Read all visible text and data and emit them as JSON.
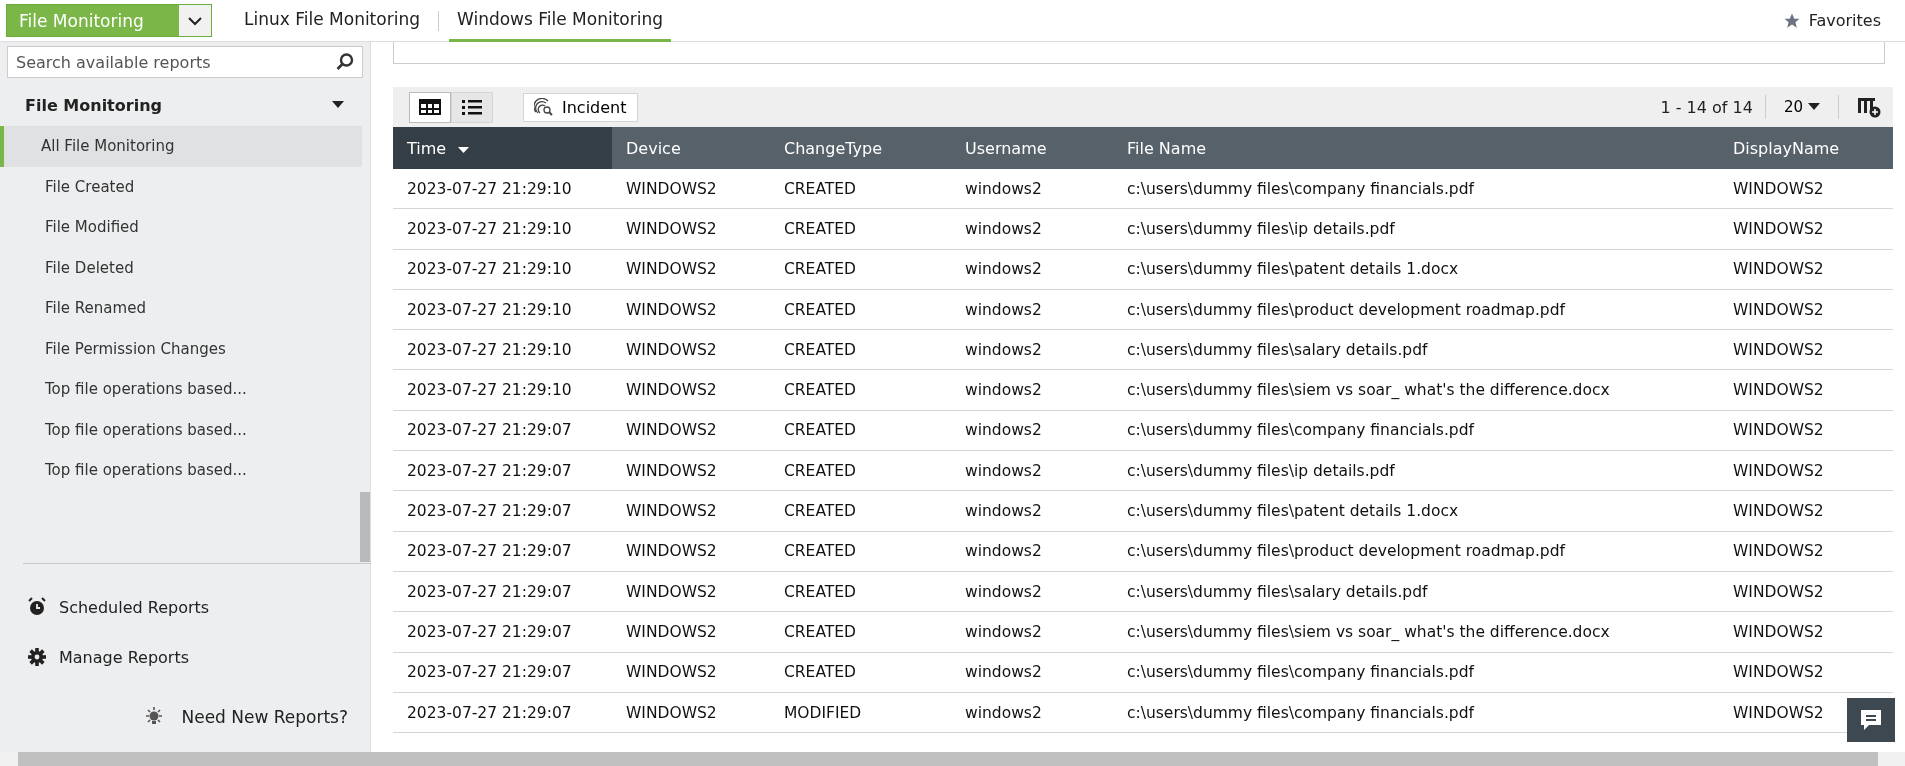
{
  "module_selector": {
    "value": "File Monitoring"
  },
  "tabs": [
    {
      "label": "Linux File Monitoring",
      "selected": false
    },
    {
      "label": "Windows File Monitoring",
      "selected": true
    }
  ],
  "favorites": {
    "label": "Favorites"
  },
  "sidebar": {
    "search": {
      "placeholder": "Search available reports"
    },
    "group": {
      "label": "File Monitoring",
      "expanded": true
    },
    "items": [
      {
        "label": "All File Monitoring",
        "selected": true
      },
      {
        "label": "File Created",
        "selected": false
      },
      {
        "label": "File Modified",
        "selected": false
      },
      {
        "label": "File Deleted",
        "selected": false
      },
      {
        "label": "File Renamed",
        "selected": false
      },
      {
        "label": "File Permission Changes",
        "selected": false
      },
      {
        "label": "Top file operations based...",
        "selected": false
      },
      {
        "label": "Top file operations based...",
        "selected": false
      },
      {
        "label": "Top file operations based...",
        "selected": false
      }
    ],
    "links": [
      {
        "kind": "alarm",
        "label": "Scheduled Reports"
      },
      {
        "kind": "gear",
        "label": "Manage Reports"
      }
    ],
    "need_new": "Need New Reports?"
  },
  "toolbar": {
    "views": [
      {
        "kind": "grid",
        "selected": true
      },
      {
        "kind": "list",
        "selected": false
      }
    ],
    "incident": "Incident",
    "range": "1 - 14 of 14",
    "page_size": "20"
  },
  "table": {
    "columns": [
      {
        "label": "Time",
        "sorted": true
      },
      {
        "label": "Device",
        "sorted": false
      },
      {
        "label": "ChangeType",
        "sorted": false
      },
      {
        "label": "Username",
        "sorted": false
      },
      {
        "label": "File Name",
        "sorted": false
      },
      {
        "label": "DisplayName",
        "sorted": false
      }
    ],
    "rows": [
      [
        "2023-07-27 21:29:10",
        "WINDOWS2",
        "CREATED",
        "windows2",
        "c:\\users\\dummy files\\company financials.pdf",
        "WINDOWS2"
      ],
      [
        "2023-07-27 21:29:10",
        "WINDOWS2",
        "CREATED",
        "windows2",
        "c:\\users\\dummy files\\ip details.pdf",
        "WINDOWS2"
      ],
      [
        "2023-07-27 21:29:10",
        "WINDOWS2",
        "CREATED",
        "windows2",
        "c:\\users\\dummy files\\patent details 1.docx",
        "WINDOWS2"
      ],
      [
        "2023-07-27 21:29:10",
        "WINDOWS2",
        "CREATED",
        "windows2",
        "c:\\users\\dummy files\\product development roadmap.pdf",
        "WINDOWS2"
      ],
      [
        "2023-07-27 21:29:10",
        "WINDOWS2",
        "CREATED",
        "windows2",
        "c:\\users\\dummy files\\salary details.pdf",
        "WINDOWS2"
      ],
      [
        "2023-07-27 21:29:10",
        "WINDOWS2",
        "CREATED",
        "windows2",
        "c:\\users\\dummy files\\siem vs soar_ what's the difference.docx",
        "WINDOWS2"
      ],
      [
        "2023-07-27 21:29:07",
        "WINDOWS2",
        "CREATED",
        "windows2",
        "c:\\users\\dummy files\\company financials.pdf",
        "WINDOWS2"
      ],
      [
        "2023-07-27 21:29:07",
        "WINDOWS2",
        "CREATED",
        "windows2",
        "c:\\users\\dummy files\\ip details.pdf",
        "WINDOWS2"
      ],
      [
        "2023-07-27 21:29:07",
        "WINDOWS2",
        "CREATED",
        "windows2",
        "c:\\users\\dummy files\\patent details 1.docx",
        "WINDOWS2"
      ],
      [
        "2023-07-27 21:29:07",
        "WINDOWS2",
        "CREATED",
        "windows2",
        "c:\\users\\dummy files\\product development roadmap.pdf",
        "WINDOWS2"
      ],
      [
        "2023-07-27 21:29:07",
        "WINDOWS2",
        "CREATED",
        "windows2",
        "c:\\users\\dummy files\\salary details.pdf",
        "WINDOWS2"
      ],
      [
        "2023-07-27 21:29:07",
        "WINDOWS2",
        "CREATED",
        "windows2",
        "c:\\users\\dummy files\\siem vs soar_ what's the difference.docx",
        "WINDOWS2"
      ],
      [
        "2023-07-27 21:29:07",
        "WINDOWS2",
        "CREATED",
        "windows2",
        "c:\\users\\dummy files\\company financials.pdf",
        "WINDOWS2"
      ],
      [
        "2023-07-27 21:29:07",
        "WINDOWS2",
        "MODIFIED",
        "windows2",
        "c:\\users\\dummy files\\company financials.pdf",
        "WINDOWS2"
      ]
    ]
  }
}
